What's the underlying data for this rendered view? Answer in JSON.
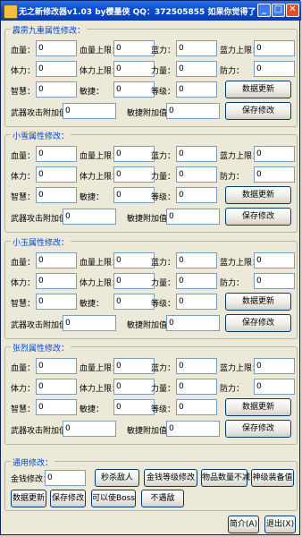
{
  "window": {
    "title": "无之新修改器v1.03 by樱墨侠 QQ：372505855 如果你觉得了BUG请告诉我",
    "min": "_",
    "max": "□",
    "close": "✕"
  },
  "labels": {
    "hp": "血量：",
    "hpmax": "血量上限：",
    "mp": "蓝力：",
    "mpmax": "蓝力上限：",
    "body": "体力：",
    "bodymax": "体力上限：",
    "str": "力量：",
    "def": "防力：",
    "int": "智慧：",
    "agi": "敏捷：",
    "lvl": "等级：",
    "weapon": "武器攻击附加值：",
    "agibonus": "敏捷附加值："
  },
  "groups": [
    {
      "title": "霹雳九重属性修改：",
      "update": "数据更新",
      "save": "保存修改"
    },
    {
      "title": "小雪属性修改：",
      "update": "数据更新",
      "save": "保存修改"
    },
    {
      "title": "小玉属性修改：",
      "update": "数据更新",
      "save": "保存修改"
    },
    {
      "title": "张烈属性修改：",
      "update": "数据更新",
      "save": "保存修改"
    }
  ],
  "general": {
    "title": "通用修改：",
    "money_label": "金钱修改：",
    "money_value": "0",
    "buttons": [
      "秒杀敌人",
      "金钱等级修改",
      "物品数量不减",
      "神级装备值",
      "数据更新",
      "保存修改",
      "可以使Boss",
      "不遇敌"
    ]
  },
  "bottom": {
    "about": "简介(A)",
    "exit": "退出(X)"
  },
  "field_value": "0"
}
